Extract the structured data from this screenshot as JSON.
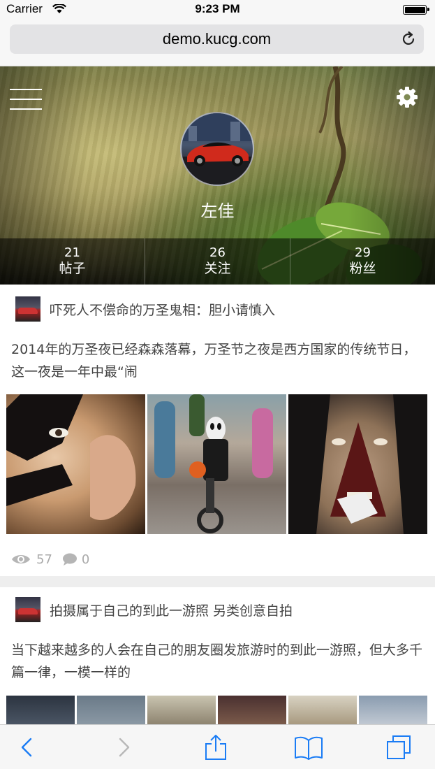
{
  "status_bar": {
    "carrier": "Carrier",
    "time": "9:23 PM"
  },
  "browser": {
    "url": "demo.kucg.com"
  },
  "profile": {
    "name": "左佳",
    "stats": [
      {
        "value": "21",
        "label": "帖子"
      },
      {
        "value": "26",
        "label": "关注"
      },
      {
        "value": "29",
        "label": "粉丝"
      }
    ]
  },
  "posts": [
    {
      "title": "吓死人不偿命的万圣鬼相：胆小请慎入",
      "body": "2014年的万圣夜已经森森落幕，万圣节之夜是西方国家的传统节日，这一夜是一年中最“闹",
      "views": "57",
      "comments": "0"
    },
    {
      "title": "拍摄属于自己的到此一游照 另类创意自拍",
      "body": "当下越来越多的人会在自己的朋友圈发旅游时的到此一游照，但大多千篇一律，一模一样的"
    }
  ],
  "colors": {
    "accent": "#1a7cf5",
    "disabled": "#b8b8b8"
  },
  "icons": [
    "wifi-icon",
    "battery-icon",
    "reload-icon",
    "menu-icon",
    "gear-icon",
    "eye-icon",
    "comment-icon",
    "back-icon",
    "forward-icon",
    "share-icon",
    "bookmarks-icon",
    "tabs-icon"
  ]
}
